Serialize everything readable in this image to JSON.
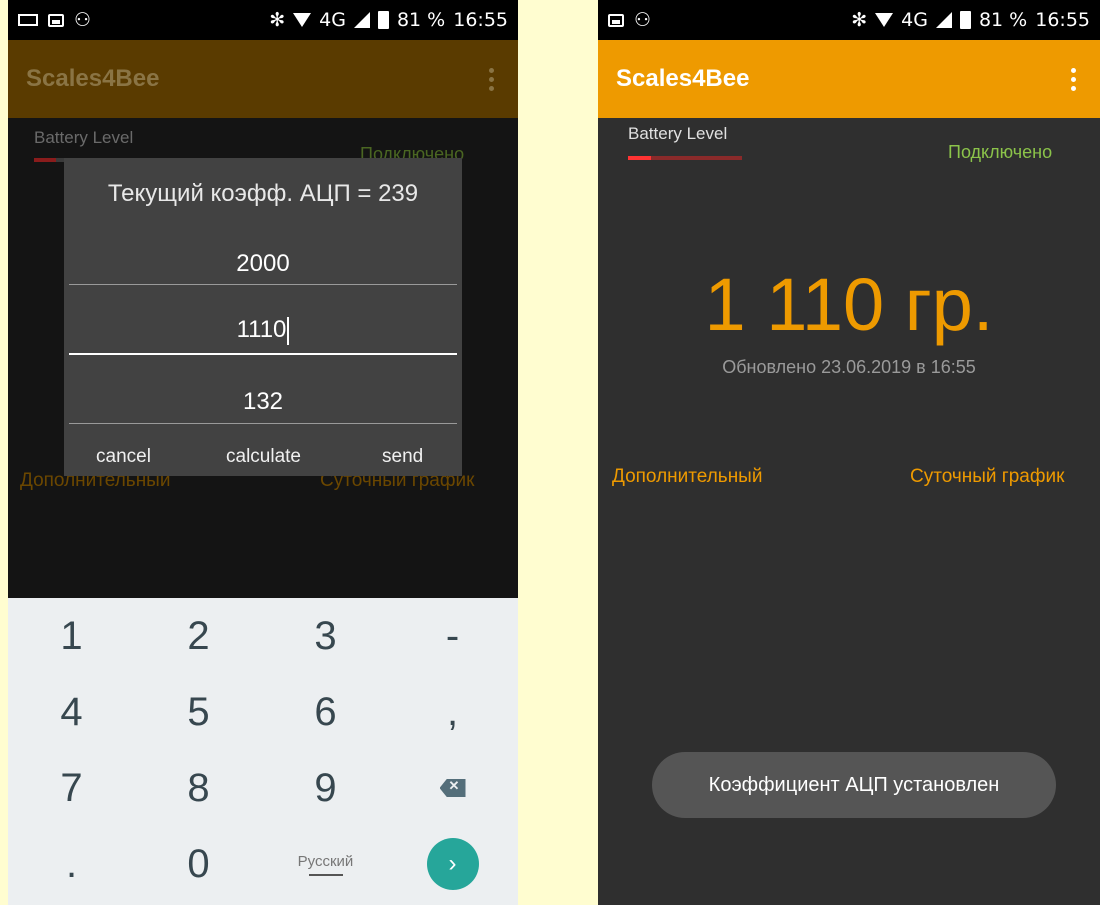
{
  "status_bar": {
    "network": "4G",
    "battery": "81 %",
    "time": "16:55"
  },
  "app": {
    "title": "Scales4Bee",
    "battery_label": "Battery Level",
    "battery_level_fraction": 0.2,
    "connection_status": "Подключено",
    "link_additional": "Дополнительный",
    "link_daily_chart": "Суточный график"
  },
  "dialog": {
    "title": "Текущий коэфф. АЦП = 239",
    "input_1": "2000",
    "input_2": "1110",
    "input_3": "132",
    "cancel_label": "cancel",
    "calculate_label": "calculate",
    "send_label": "send"
  },
  "keyboard": {
    "keys": [
      "1",
      "2",
      "3",
      "-",
      "4",
      "5",
      "6",
      ",",
      "7",
      "8",
      "9",
      "⌫",
      ".",
      "0",
      "Русский",
      "›"
    ],
    "language_label": "Русский"
  },
  "result": {
    "weight": "1 110 гр.",
    "updated": "Обновлено 23.06.2019 в 16:55",
    "toast": "Коэффициент АЦП установлен"
  },
  "colors": {
    "accent": "#ee9a00",
    "connected": "#8bc34a",
    "dim_accent": "#5a3b00"
  }
}
